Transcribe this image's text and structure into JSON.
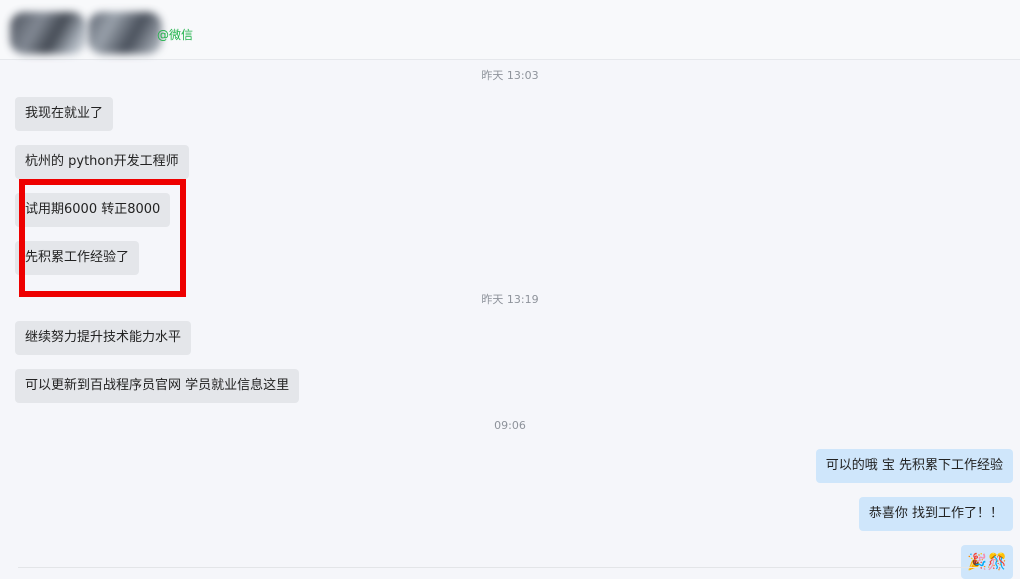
{
  "header": {
    "wechat_label": "@微信"
  },
  "timestamps": {
    "t1": "昨天 13:03",
    "t2": "昨天 13:19",
    "t3": "09:06"
  },
  "messages": [
    {
      "side": "incoming",
      "text": "我现在就业了"
    },
    {
      "side": "incoming",
      "text": "杭州的 python开发工程师"
    },
    {
      "side": "incoming",
      "text": "试用期6000 转正8000"
    },
    {
      "side": "incoming",
      "text": "先积累工作经验了"
    },
    {
      "side": "incoming",
      "text": "继续努力提升技术能力水平"
    },
    {
      "side": "incoming",
      "text": "可以更新到百战程序员官网 学员就业信息这里"
    },
    {
      "side": "outgoing",
      "text": "可以的哦 宝  先积累下工作经验"
    },
    {
      "side": "outgoing",
      "text": "恭喜你 找到工作了！！"
    },
    {
      "side": "outgoing",
      "text": "🎉🎊"
    }
  ],
  "colors": {
    "incoming_bubble": "#e4e6ea",
    "outgoing_bubble": "#cfe6fb",
    "highlight_box": "#ee0000",
    "wechat_green": "#21b34b"
  }
}
